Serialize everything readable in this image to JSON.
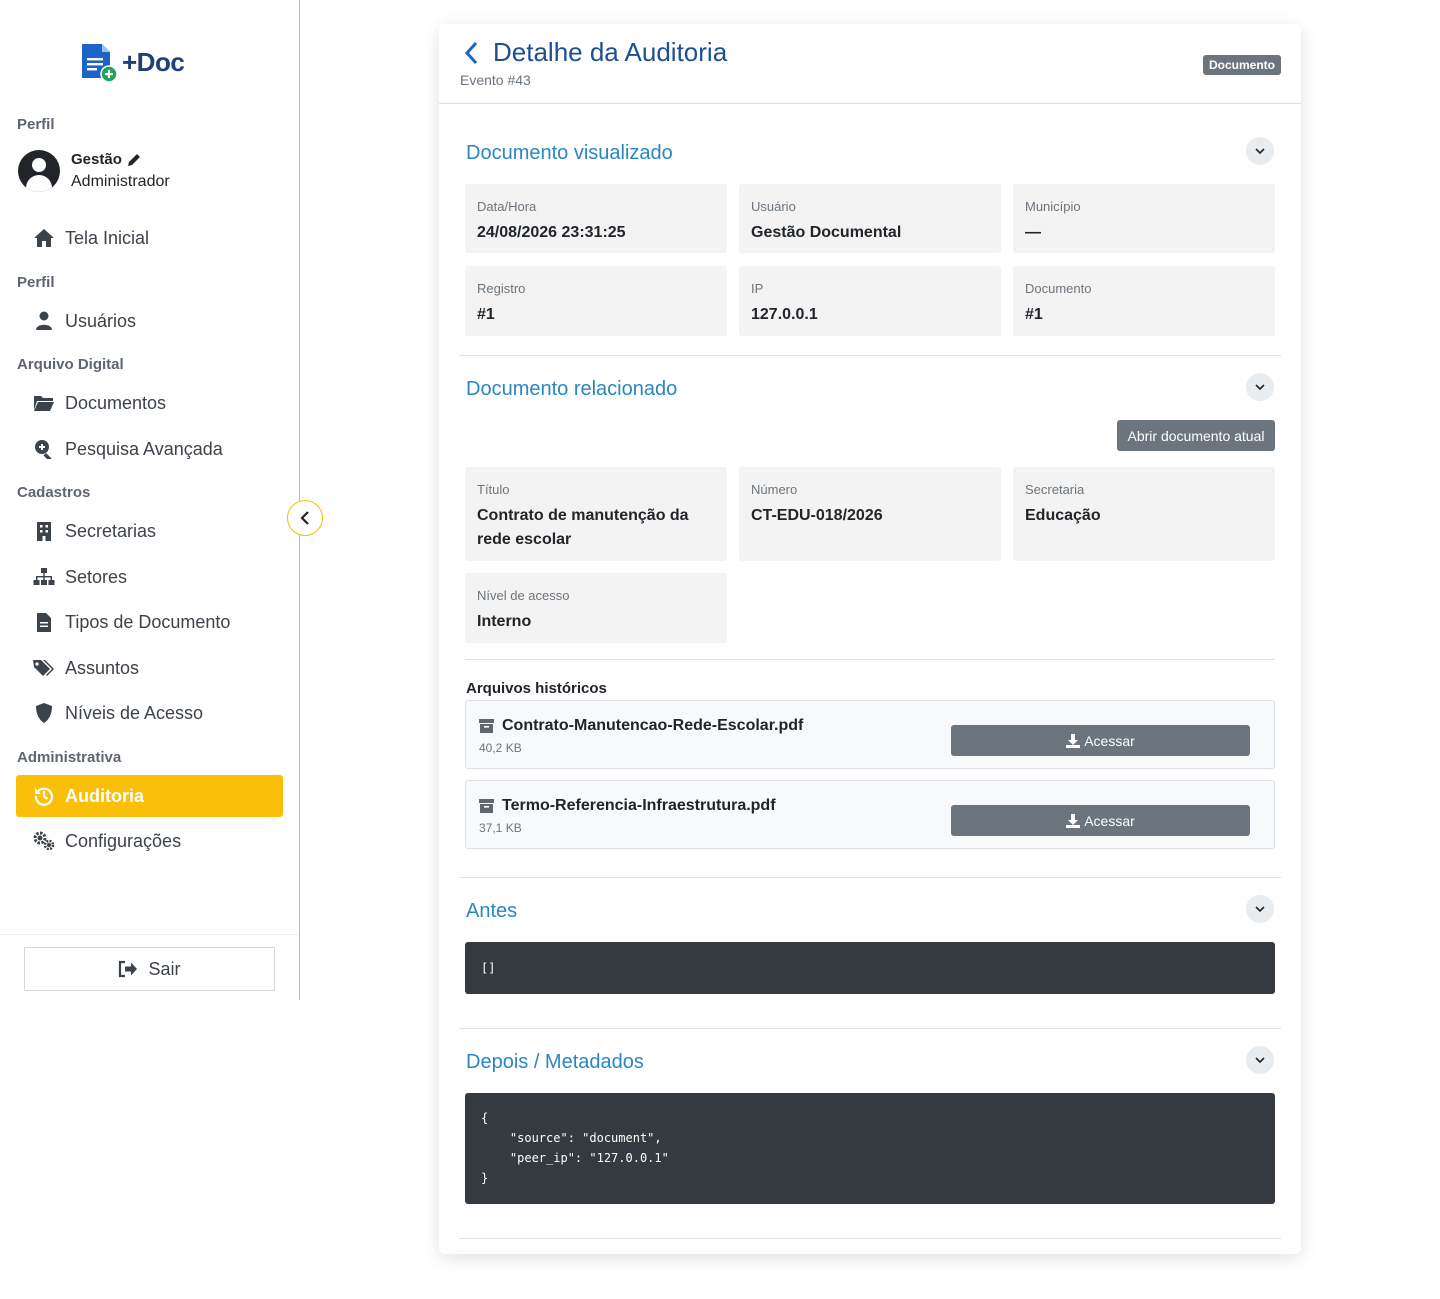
{
  "sidebar": {
    "logo": {
      "text": "+Doc"
    },
    "profile_section": "Perfil",
    "profile": {
      "name": "Gestão",
      "role": "Administrador"
    },
    "sections": {
      "perfil": "Perfil",
      "arquivo": "Arquivo Digital",
      "cadastros": "Cadastros",
      "administrativa": "Administrativa"
    },
    "items": [
      {
        "label": "Tela Inicial",
        "icon": "home-icon"
      },
      {
        "label": "Usuários",
        "icon": "user-icon"
      },
      {
        "label": "Documentos",
        "icon": "folder-icon"
      },
      {
        "label": "Pesquisa Avançada",
        "icon": "search-plus-icon"
      },
      {
        "label": "Secretarias",
        "icon": "building-icon"
      },
      {
        "label": "Setores",
        "icon": "sitemap-icon"
      },
      {
        "label": "Tipos de Documento",
        "icon": "file-icon"
      },
      {
        "label": "Assuntos",
        "icon": "tags-icon"
      },
      {
        "label": "Níveis de Acesso",
        "icon": "shield-icon"
      },
      {
        "label": "Auditoria",
        "icon": "history-icon",
        "active": true
      },
      {
        "label": "Configurações",
        "icon": "cogs-icon"
      }
    ],
    "logout": "Sair",
    "accent_color": "#f9bf0a"
  },
  "header": {
    "title": "Detalhe da Auditoria",
    "subtitle": "Evento #43",
    "badge": "Documento"
  },
  "viewed": {
    "title": "Documento visualizado",
    "fields": [
      {
        "label": "Data/Hora",
        "value": "24/08/2026 23:31:25"
      },
      {
        "label": "Usuário",
        "value": "Gestão Documental"
      },
      {
        "label": "Município",
        "value": "—"
      },
      {
        "label": "Registro",
        "value": "#1"
      },
      {
        "label": "IP",
        "value": "127.0.0.1"
      },
      {
        "label": "Documento",
        "value": "#1"
      }
    ]
  },
  "related": {
    "title": "Documento relacionado",
    "open_button": "Abrir documento atual",
    "fields": [
      {
        "label": "Título",
        "value": "Contrato de manutenção da rede escolar"
      },
      {
        "label": "Número",
        "value": "CT-EDU-018/2026"
      },
      {
        "label": "Secretaria",
        "value": "Educação"
      },
      {
        "label": "Nível de acesso",
        "value": "Interno"
      }
    ],
    "history_title": "Arquivos históricos",
    "files": [
      {
        "name": "Contrato-Manutencao-Rede-Escolar.pdf",
        "size": "40,2 KB",
        "action": "Acessar"
      },
      {
        "name": "Termo-Referencia-Infraestrutura.pdf",
        "size": "37,1 KB",
        "action": "Acessar"
      }
    ]
  },
  "before": {
    "title": "Antes",
    "code": "[]"
  },
  "after": {
    "title": "Depois / Metadados",
    "code": "{\n    \"source\": \"document\",\n    \"peer_ip\": \"127.0.0.1\"\n}"
  }
}
